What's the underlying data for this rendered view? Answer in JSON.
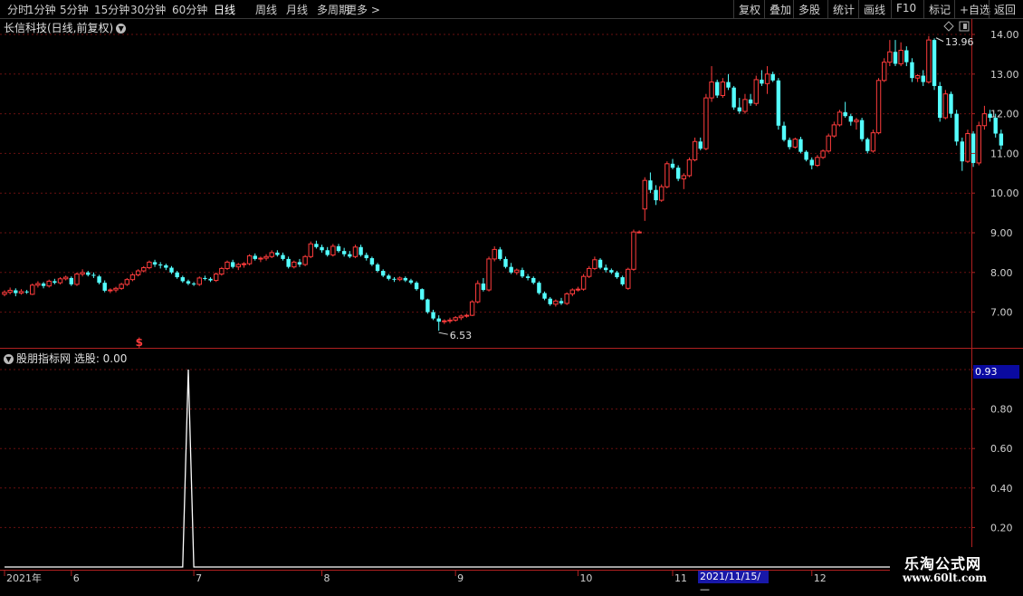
{
  "toolbar": {
    "left_items": [
      "分时",
      "1分钟",
      "5分钟",
      "15分钟",
      "30分钟",
      "60分钟",
      "日线",
      "周线",
      "月线",
      "多周期",
      "更多 >"
    ],
    "active": "日线",
    "right_items": [
      "复权",
      "叠加",
      "多股",
      "统计",
      "画线",
      "F10",
      "标记",
      "+自选",
      "返回"
    ]
  },
  "stock_title": "长信科技(日线,前复权)",
  "indicator_title": "股朋指标网  选股: 0.00",
  "cursor_value": "0.93",
  "date_box": "2021/11/15/—",
  "logo": {
    "line1": "乐淘公式网",
    "line2": "www.60lt.com"
  },
  "colors": {
    "up": "#ff3c3c",
    "down": "#54ffff",
    "grid": "#6a1010",
    "axis": "#b02020",
    "line": "#ffffff"
  },
  "chart_data": {
    "type": "candlestick",
    "price_axis": {
      "ticks": [
        7.0,
        8.0,
        9.0,
        10.0,
        11.0,
        12.0,
        13.0,
        14.0
      ]
    },
    "indicator_axis": {
      "ticks": [
        0.2,
        0.4,
        0.6,
        0.8,
        1.0
      ]
    },
    "annotations": [
      {
        "label": "13.96",
        "index": 167,
        "value": 13.96,
        "kind": "high"
      },
      {
        "label": "6.53",
        "index": 78,
        "value": 6.53,
        "kind": "low"
      },
      {
        "label": "$",
        "index": 24,
        "kind": "signal"
      }
    ],
    "x_axis_labels": [
      {
        "label": "2021年",
        "index": 0
      },
      {
        "label": "6",
        "index": 12
      },
      {
        "label": "7",
        "index": 34
      },
      {
        "label": "8",
        "index": 57
      },
      {
        "label": "9",
        "index": 81
      },
      {
        "label": "10",
        "index": 103
      },
      {
        "label": "11",
        "index": 120
      },
      {
        "label": "12",
        "index": 145
      }
    ],
    "indicator_spike": {
      "index": 33,
      "value": 1.0
    },
    "candles": [
      [
        7.45,
        7.55,
        7.4,
        7.5
      ],
      [
        7.5,
        7.62,
        7.45,
        7.55
      ],
      [
        7.55,
        7.6,
        7.4,
        7.48
      ],
      [
        7.48,
        7.58,
        7.44,
        7.52
      ],
      [
        7.52,
        7.56,
        7.46,
        7.5
      ],
      [
        7.45,
        7.72,
        7.43,
        7.68
      ],
      [
        7.68,
        7.78,
        7.62,
        7.72
      ],
      [
        7.72,
        7.76,
        7.6,
        7.66
      ],
      [
        7.66,
        7.82,
        7.62,
        7.78
      ],
      [
        7.78,
        7.84,
        7.7,
        7.74
      ],
      [
        7.74,
        7.88,
        7.7,
        7.84
      ],
      [
        7.84,
        7.92,
        7.8,
        7.88
      ],
      [
        7.86,
        7.9,
        7.66,
        7.7
      ],
      [
        7.7,
        8.0,
        7.66,
        7.96
      ],
      [
        7.96,
        8.08,
        7.9,
        8.0
      ],
      [
        8.0,
        8.04,
        7.9,
        7.94
      ],
      [
        7.94,
        8.0,
        7.86,
        7.92
      ],
      [
        7.9,
        7.94,
        7.7,
        7.74
      ],
      [
        7.74,
        7.8,
        7.5,
        7.54
      ],
      [
        7.54,
        7.6,
        7.48,
        7.56
      ],
      [
        7.56,
        7.64,
        7.5,
        7.6
      ],
      [
        7.6,
        7.74,
        7.56,
        7.7
      ],
      [
        7.7,
        7.86,
        7.66,
        7.82
      ],
      [
        7.82,
        7.98,
        7.78,
        7.94
      ],
      [
        7.94,
        8.08,
        7.9,
        8.04
      ],
      [
        8.04,
        8.16,
        8.0,
        8.12
      ],
      [
        8.12,
        8.3,
        8.08,
        8.26
      ],
      [
        8.26,
        8.32,
        8.14,
        8.2
      ],
      [
        8.2,
        8.26,
        8.1,
        8.18
      ],
      [
        8.18,
        8.22,
        8.06,
        8.12
      ],
      [
        8.12,
        8.16,
        7.96,
        8.0
      ],
      [
        8.0,
        8.04,
        7.84,
        7.88
      ],
      [
        7.88,
        7.92,
        7.74,
        7.78
      ],
      [
        7.78,
        7.82,
        7.68,
        7.72
      ],
      [
        7.72,
        7.76,
        7.66,
        7.7
      ],
      [
        7.7,
        7.9,
        7.66,
        7.86
      ],
      [
        7.86,
        7.92,
        7.8,
        7.84
      ],
      [
        7.84,
        7.88,
        7.76,
        7.8
      ],
      [
        7.8,
        8.0,
        7.76,
        7.96
      ],
      [
        7.96,
        8.14,
        7.92,
        8.1
      ],
      [
        8.1,
        8.3,
        8.06,
        8.26
      ],
      [
        8.26,
        8.32,
        8.1,
        8.14
      ],
      [
        8.14,
        8.24,
        8.06,
        8.2
      ],
      [
        8.2,
        8.26,
        8.12,
        8.22
      ],
      [
        8.22,
        8.46,
        8.18,
        8.42
      ],
      [
        8.42,
        8.48,
        8.3,
        8.34
      ],
      [
        8.34,
        8.4,
        8.26,
        8.36
      ],
      [
        8.36,
        8.46,
        8.3,
        8.4
      ],
      [
        8.4,
        8.56,
        8.36,
        8.5
      ],
      [
        8.5,
        8.56,
        8.4,
        8.44
      ],
      [
        8.44,
        8.5,
        8.3,
        8.34
      ],
      [
        8.34,
        8.4,
        8.1,
        8.14
      ],
      [
        8.14,
        8.3,
        8.1,
        8.26
      ],
      [
        8.26,
        8.34,
        8.14,
        8.2
      ],
      [
        8.2,
        8.44,
        8.16,
        8.4
      ],
      [
        8.4,
        8.78,
        8.36,
        8.72
      ],
      [
        8.72,
        8.8,
        8.6,
        8.64
      ],
      [
        8.64,
        8.7,
        8.5,
        8.56
      ],
      [
        8.56,
        8.64,
        8.4,
        8.44
      ],
      [
        8.44,
        8.72,
        8.4,
        8.66
      ],
      [
        8.66,
        8.72,
        8.5,
        8.54
      ],
      [
        8.54,
        8.62,
        8.4,
        8.46
      ],
      [
        8.46,
        8.54,
        8.36,
        8.4
      ],
      [
        8.4,
        8.7,
        8.36,
        8.64
      ],
      [
        8.64,
        8.7,
        8.4,
        8.44
      ],
      [
        8.44,
        8.5,
        8.3,
        8.36
      ],
      [
        8.36,
        8.4,
        8.16,
        8.2
      ],
      [
        8.2,
        8.24,
        8.0,
        8.04
      ],
      [
        8.04,
        8.08,
        7.88,
        7.92
      ],
      [
        7.92,
        7.96,
        7.8,
        7.84
      ],
      [
        7.84,
        7.88,
        7.76,
        7.82
      ],
      [
        7.82,
        7.9,
        7.78,
        7.86
      ],
      [
        7.86,
        7.9,
        7.76,
        7.8
      ],
      [
        7.8,
        7.84,
        7.7,
        7.74
      ],
      [
        7.74,
        7.78,
        7.54,
        7.58
      ],
      [
        7.58,
        7.6,
        7.3,
        7.32
      ],
      [
        7.32,
        7.34,
        6.96,
        7.0
      ],
      [
        7.0,
        7.06,
        6.8,
        6.84
      ],
      [
        6.84,
        6.92,
        6.53,
        6.76
      ],
      [
        6.76,
        6.82,
        6.7,
        6.78
      ],
      [
        6.78,
        6.86,
        6.72,
        6.8
      ],
      [
        6.8,
        6.9,
        6.76,
        6.86
      ],
      [
        6.86,
        6.94,
        6.8,
        6.9
      ],
      [
        6.9,
        6.96,
        6.86,
        6.92
      ],
      [
        6.92,
        7.3,
        6.9,
        7.26
      ],
      [
        7.26,
        7.8,
        7.22,
        7.72
      ],
      [
        7.72,
        7.86,
        7.52,
        7.56
      ],
      [
        7.56,
        8.4,
        7.52,
        8.34
      ],
      [
        8.34,
        8.66,
        8.28,
        8.58
      ],
      [
        8.58,
        8.64,
        8.3,
        8.34
      ],
      [
        8.34,
        8.4,
        8.1,
        8.14
      ],
      [
        8.14,
        8.24,
        7.96,
        8.0
      ],
      [
        8.0,
        8.1,
        7.94,
        8.06
      ],
      [
        8.06,
        8.12,
        7.86,
        7.9
      ],
      [
        7.9,
        7.96,
        7.8,
        7.86
      ],
      [
        7.86,
        7.9,
        7.7,
        7.74
      ],
      [
        7.74,
        7.78,
        7.44,
        7.48
      ],
      [
        7.48,
        7.52,
        7.3,
        7.34
      ],
      [
        7.34,
        7.38,
        7.16,
        7.2
      ],
      [
        7.2,
        7.32,
        7.14,
        7.28
      ],
      [
        7.28,
        7.36,
        7.18,
        7.22
      ],
      [
        7.22,
        7.5,
        7.18,
        7.46
      ],
      [
        7.46,
        7.6,
        7.4,
        7.56
      ],
      [
        7.56,
        7.64,
        7.52,
        7.58
      ],
      [
        7.58,
        7.96,
        7.54,
        7.9
      ],
      [
        7.9,
        8.16,
        7.86,
        8.1
      ],
      [
        8.1,
        8.4,
        8.06,
        8.32
      ],
      [
        8.32,
        8.36,
        8.08,
        8.12
      ],
      [
        8.12,
        8.2,
        8.0,
        8.06
      ],
      [
        8.06,
        8.1,
        7.96,
        8.0
      ],
      [
        8.0,
        8.04,
        7.84,
        7.88
      ],
      [
        7.88,
        7.92,
        7.66,
        7.7
      ],
      [
        7.6,
        8.12,
        7.56,
        8.08
      ],
      [
        8.08,
        9.08,
        8.04,
        9.02
      ],
      [
        9.02,
        9.06,
        9.0,
        9.02
      ],
      [
        9.6,
        10.4,
        9.3,
        10.32
      ],
      [
        10.32,
        10.52,
        10.0,
        10.08
      ],
      [
        10.08,
        10.2,
        9.7,
        9.82
      ],
      [
        9.82,
        10.22,
        9.78,
        10.16
      ],
      [
        10.16,
        10.8,
        10.12,
        10.74
      ],
      [
        10.74,
        10.86,
        10.6,
        10.64
      ],
      [
        10.64,
        10.7,
        10.3,
        10.36
      ],
      [
        10.36,
        10.5,
        10.1,
        10.44
      ],
      [
        10.44,
        10.9,
        10.4,
        10.84
      ],
      [
        10.84,
        11.4,
        10.8,
        11.3
      ],
      [
        11.3,
        11.4,
        11.08,
        11.12
      ],
      [
        11.12,
        12.5,
        11.08,
        12.4
      ],
      [
        12.4,
        13.2,
        12.3,
        12.8
      ],
      [
        12.8,
        12.86,
        12.4,
        12.46
      ],
      [
        12.46,
        12.9,
        12.4,
        12.8
      ],
      [
        12.8,
        13.0,
        12.6,
        12.66
      ],
      [
        12.66,
        12.7,
        12.1,
        12.16
      ],
      [
        12.16,
        12.4,
        12.0,
        12.06
      ],
      [
        12.06,
        12.5,
        12.0,
        12.36
      ],
      [
        12.36,
        12.5,
        12.2,
        12.26
      ],
      [
        12.26,
        12.96,
        12.2,
        12.86
      ],
      [
        12.86,
        13.1,
        12.7,
        12.76
      ],
      [
        12.76,
        13.2,
        12.5,
        13.0
      ],
      [
        13.0,
        13.06,
        12.8,
        12.84
      ],
      [
        12.84,
        12.9,
        11.6,
        11.7
      ],
      [
        11.7,
        11.8,
        11.3,
        11.34
      ],
      [
        11.34,
        11.4,
        11.1,
        11.16
      ],
      [
        11.16,
        11.4,
        11.12,
        11.36
      ],
      [
        11.36,
        11.42,
        11.0,
        11.04
      ],
      [
        11.04,
        11.08,
        10.8,
        10.84
      ],
      [
        10.84,
        10.9,
        10.6,
        10.7
      ],
      [
        10.7,
        10.96,
        10.66,
        10.9
      ],
      [
        10.9,
        11.1,
        10.86,
        11.06
      ],
      [
        11.06,
        11.5,
        11.02,
        11.44
      ],
      [
        11.44,
        11.8,
        11.4,
        11.72
      ],
      [
        11.72,
        12.1,
        11.68,
        12.04
      ],
      [
        12.04,
        12.3,
        11.9,
        11.94
      ],
      [
        11.94,
        12.0,
        11.7,
        11.8
      ],
      [
        11.8,
        11.9,
        11.6,
        11.84
      ],
      [
        11.84,
        11.9,
        11.3,
        11.36
      ],
      [
        11.36,
        11.4,
        11.0,
        11.06
      ],
      [
        11.06,
        11.6,
        11.02,
        11.52
      ],
      [
        11.52,
        12.9,
        11.48,
        12.84
      ],
      [
        12.84,
        13.4,
        12.8,
        13.3
      ],
      [
        13.3,
        13.86,
        13.2,
        13.56
      ],
      [
        13.56,
        13.86,
        13.2,
        13.26
      ],
      [
        13.26,
        13.8,
        13.2,
        13.6
      ],
      [
        13.6,
        13.7,
        13.2,
        13.3
      ],
      [
        13.3,
        13.4,
        12.8,
        12.9
      ],
      [
        12.9,
        13.0,
        12.8,
        12.96
      ],
      [
        12.96,
        13.1,
        12.7,
        12.8
      ],
      [
        12.8,
        13.96,
        12.76,
        13.86
      ],
      [
        13.86,
        13.9,
        12.6,
        12.7
      ],
      [
        12.7,
        12.8,
        11.8,
        11.9
      ],
      [
        11.9,
        12.6,
        11.86,
        12.5
      ],
      [
        12.5,
        12.56,
        11.9,
        12.0
      ],
      [
        12.0,
        12.1,
        11.2,
        11.3
      ],
      [
        11.3,
        11.4,
        10.56,
        10.8
      ],
      [
        10.8,
        11.6,
        10.76,
        11.5
      ],
      [
        11.5,
        11.56,
        10.66,
        10.76
      ],
      [
        10.76,
        11.8,
        10.7,
        11.7
      ],
      [
        11.7,
        12.2,
        11.6,
        12.0
      ],
      [
        12.0,
        12.1,
        11.8,
        11.9
      ],
      [
        11.9,
        12.0,
        11.4,
        11.5
      ],
      [
        11.5,
        11.6,
        11.1,
        11.2
      ]
    ]
  }
}
